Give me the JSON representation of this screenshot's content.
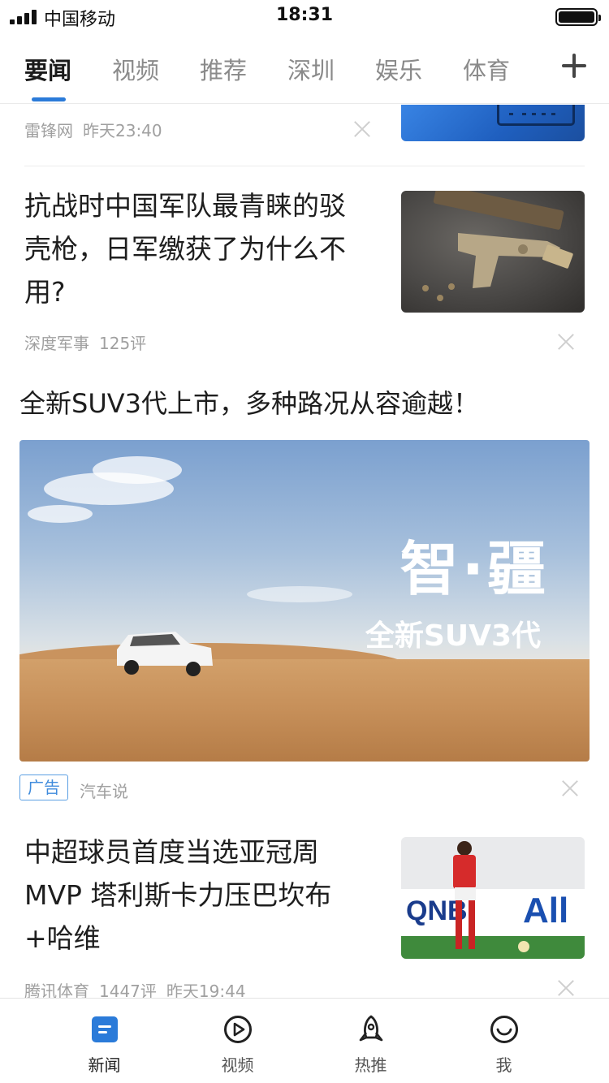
{
  "status_bar": {
    "carrier": "中国移动",
    "time": "18:31",
    "battery_level": 1.0
  },
  "tabs": {
    "items": [
      {
        "label": "要闻",
        "active": true
      },
      {
        "label": "视频",
        "active": false
      },
      {
        "label": "推荐",
        "active": false
      },
      {
        "label": "深圳",
        "active": false
      },
      {
        "label": "娱乐",
        "active": false
      },
      {
        "label": "体育",
        "active": false
      }
    ],
    "add_icon": "plus-icon"
  },
  "feed": {
    "item0": {
      "source": "雷锋网",
      "time": "昨天23:40"
    },
    "item1": {
      "title_line1": "抗战时中国军队最青睐的驳",
      "title_line2": "壳枪，日军缴获了为什么不",
      "title_line3": "用?",
      "source": "深度军事",
      "comments": "125评"
    },
    "ad": {
      "title": "全新SUV3代上市，多种路况从容逾越！",
      "banner_brand": "智·疆",
      "banner_sub": "全新SUV3代",
      "badge": "广告",
      "source": "汽车说"
    },
    "item3": {
      "title_line1": "中超球员首度当选亚冠周",
      "title_line2": "MVP 塔利斯卡力压巴坎布",
      "title_line3": "+哈维",
      "source": "腾讯体育",
      "comments": "1447评",
      "time": "昨天19:44",
      "board_left": "QNB",
      "board_right": "All"
    }
  },
  "bottom_nav": {
    "items": [
      {
        "label": "新闻",
        "icon": "news-icon",
        "active": true
      },
      {
        "label": "视频",
        "icon": "play-icon",
        "active": false
      },
      {
        "label": "热推",
        "icon": "rocket-icon",
        "active": false
      },
      {
        "label": "我",
        "icon": "smile-icon",
        "active": false
      }
    ]
  },
  "colors": {
    "accent": "#2b7bd9",
    "tab_inactive": "#8a8a8a",
    "meta_text": "#a0a0a0"
  }
}
